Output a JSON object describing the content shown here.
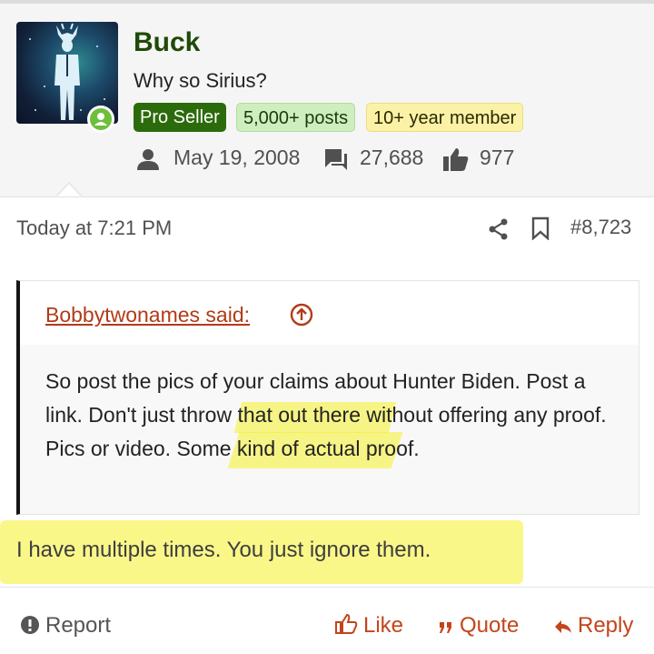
{
  "user": {
    "name": "Buck",
    "title": "Why so Sirius?",
    "badges": [
      "Pro Seller",
      "5,000+ posts",
      "10+ year member"
    ],
    "joined": "May 19, 2008",
    "messages": "27,688",
    "reactions": "977"
  },
  "post": {
    "timestamp": "Today at 7:21 PM",
    "number": "#8,723",
    "quote": {
      "author": "Bobbytwonames said:",
      "text": "So post the pics of your claims about Hunter Biden. Post a link. Don't just throw that out there without offering any proof. Pics or video. Some kind of actual proof."
    },
    "reply_text": "I have multiple times. You just ignore them."
  },
  "actions": {
    "report": "Report",
    "like": "Like",
    "quote": "Quote",
    "reply": "Reply"
  },
  "colors": {
    "username": "#1f4a07",
    "accent": "#c3451a",
    "highlight": "#f5f028"
  }
}
